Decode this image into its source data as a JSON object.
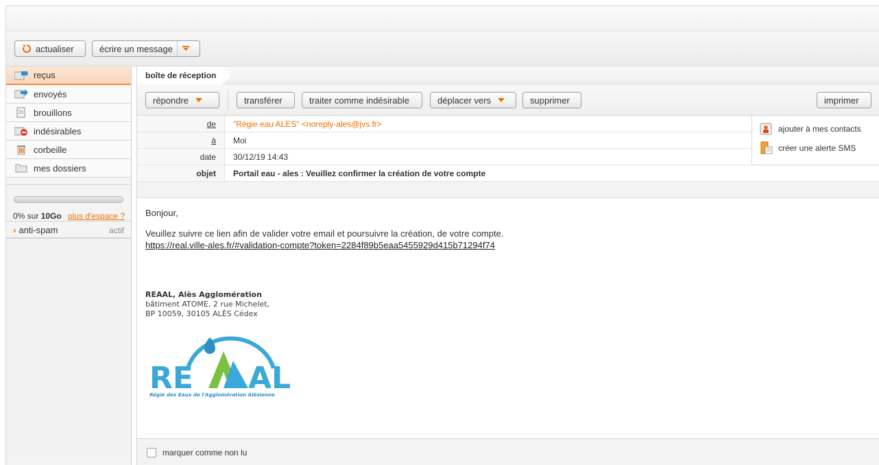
{
  "toolbar": {
    "refresh_label": "actualiser",
    "compose_label": "écrire un message"
  },
  "sidebar": {
    "folders": [
      {
        "label": "reçus",
        "icon": "inbox-icon",
        "active": true
      },
      {
        "label": "envoyés",
        "icon": "sent-icon"
      },
      {
        "label": "brouillons",
        "icon": "draft-icon"
      },
      {
        "label": "indésirables",
        "icon": "spam-icon"
      },
      {
        "label": "corbeille",
        "icon": "trash-icon"
      },
      {
        "label": "mes dossiers",
        "icon": "folder-icon"
      }
    ],
    "quota": {
      "used_fraction": 0.0,
      "percent_text": "0% sur ",
      "capacity": "10Go",
      "more_space_link": "plus d'espace ?"
    },
    "antispam": {
      "label": "anti-spam",
      "status": "actif"
    }
  },
  "main": {
    "breadcrumb": "boîte de réception",
    "actions": {
      "reply": "répondre",
      "forward": "transférer",
      "mark_spam": "traiter comme indésirable",
      "move_to": "déplacer vers",
      "delete": "supprimer",
      "print": "imprimer"
    },
    "headers": {
      "from_label": "de",
      "from_value": "\"Régie eau ALES\" <noreply-ales@jvs.fr>",
      "to_label": "à",
      "to_value": "Moi",
      "date_label": "date",
      "date_value": "30/12/19 14:43",
      "subject_label": "objet",
      "subject_value": "Portail eau - ales : Veuillez confirmer la création de votre compte"
    },
    "contact_actions": {
      "add_contact": "ajouter à mes contacts",
      "sms_alert": "créer une alerte SMS"
    },
    "body": {
      "greeting": "Bonjour,",
      "line": "Veuillez suivre ce lien afin de valider votre email et poursuivre la création, de votre compte.",
      "link": "https://real.ville-ales.fr/#validation-compte?token=2284f89b5eaa5455929d415b71294f74",
      "signature": {
        "org": "REAAL, Alès Agglomération",
        "address1": "bâtiment ATOME, 2 rue Michelet,",
        "address2": "BP 10059, 30105 ALÈS Cédex"
      },
      "logo": {
        "text_left": "RE",
        "text_right": "AL",
        "tagline": "Régie des Eaux de l'Agglomération Alésienne"
      }
    },
    "footer": {
      "mark_unread": "marquer comme non lu"
    }
  },
  "colors": {
    "accent": "#f06d00",
    "active_folder": "#f9d6bc",
    "logo_blue": "#3aa8d8",
    "logo_green": "#7ac043"
  }
}
